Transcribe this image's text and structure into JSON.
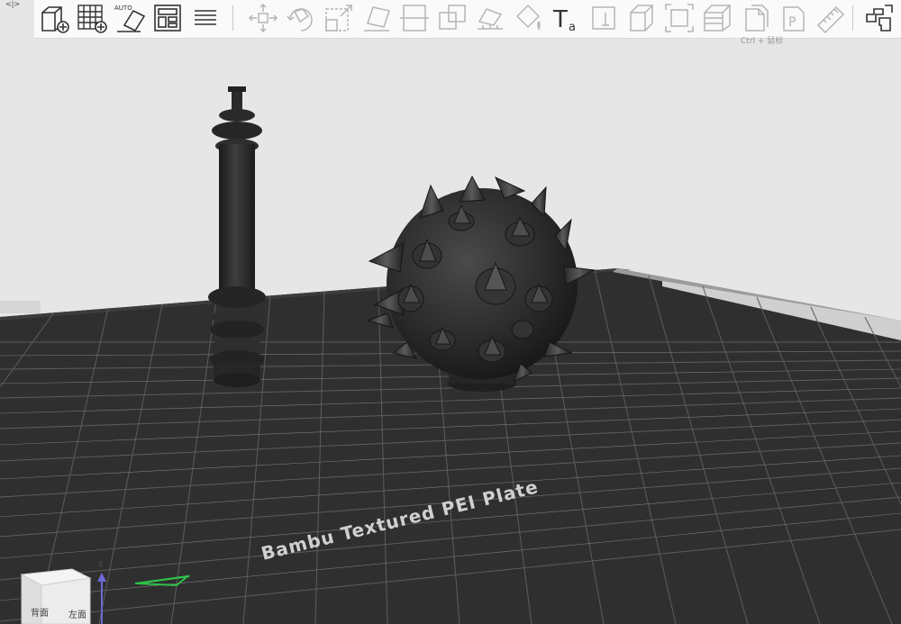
{
  "toolbar": {
    "tools": [
      {
        "name": "add-object-button",
        "icon": "cube-plus-icon"
      },
      {
        "name": "add-plate-button",
        "icon": "grid-plus-icon"
      },
      {
        "name": "auto-orient-button",
        "icon": "auto-orient-icon",
        "label": "AUTO"
      },
      {
        "name": "arrange-button",
        "icon": "arrange-icon"
      },
      {
        "name": "plate-settings-button",
        "icon": "list-lines-icon"
      },
      {
        "name": "move-button",
        "icon": "move-arrows-icon"
      },
      {
        "name": "rotate-button",
        "icon": "rotate-icon"
      },
      {
        "name": "scale-button",
        "icon": "scale-icon"
      },
      {
        "name": "lay-on-face-button",
        "icon": "lay-face-icon"
      },
      {
        "name": "cut-button",
        "icon": "cut-icon"
      },
      {
        "name": "boolean-button",
        "icon": "boolean-icon"
      },
      {
        "name": "support-paint-button",
        "icon": "support-paint-icon"
      },
      {
        "name": "color-paint-button",
        "icon": "paint-bucket-icon"
      },
      {
        "name": "text-button",
        "icon": "text-icon"
      },
      {
        "name": "emboss-button",
        "icon": "emboss-icon"
      },
      {
        "name": "assembly-button",
        "icon": "box-icon"
      },
      {
        "name": "fit-view-button",
        "icon": "fit-view-icon"
      },
      {
        "name": "layers-button",
        "icon": "layers-icon"
      },
      {
        "name": "variable-layer-button",
        "icon": "variable-layer-icon"
      },
      {
        "name": "plate-p-button",
        "icon": "plate-p-icon"
      },
      {
        "name": "measure-button",
        "icon": "ruler-icon"
      },
      {
        "name": "split-parts-button",
        "icon": "puzzle-icon"
      }
    ],
    "text_tool_glyph": "T",
    "text_tool_sub": "a",
    "plate_tool_glyph": "P"
  },
  "hint_text": "Ctrl + 鼠标",
  "plate_label": "Bambu Textured PEI Plate",
  "nav_cube": {
    "back": "背面",
    "left": "左面"
  },
  "axis": {
    "z": "z"
  },
  "colors": {
    "background": "#e6e6e6",
    "plate": "#2f2f2f",
    "grid": "#5d5d5d",
    "model": "#2b2b2b",
    "axis_z": "#6b6bd6",
    "axis_y": "#2ec24a"
  }
}
